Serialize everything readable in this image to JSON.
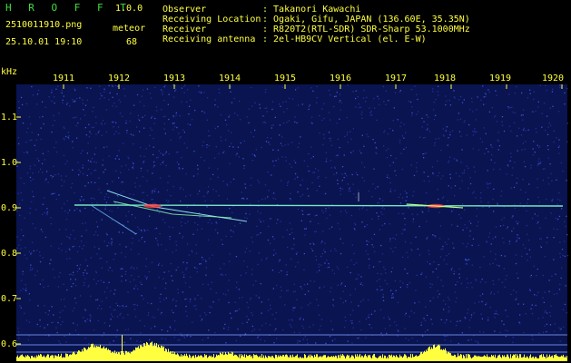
{
  "header": {
    "app_title": "H R O F F T",
    "version": "1.0.0",
    "filename": "2510011910.png",
    "meteor_label": "meteor",
    "datetime": "25.10.01 19:10",
    "meteor_count": "68",
    "info_labels": [
      "Observer",
      "Receiving Location",
      "Receiver",
      "Receiving antenna"
    ],
    "info_values": [
      ": Takanori Kawachi",
      ": Ogaki, Gifu, JAPAN (136.60E, 35.35N)",
      ": R820T2(RTL-SDR) SDR-Sharp 53.1000MHz",
      ": 2el-HB9CV Vertical (el. E-W)"
    ]
  },
  "axis": {
    "y_unit": "kHz",
    "x_ticks": [
      "1911",
      "1912",
      "1913",
      "1914",
      "1915",
      "1916",
      "1917",
      "1918",
      "1919",
      "1920"
    ],
    "y_ticks": [
      "1.1",
      "1.0",
      "0.9",
      "0.8",
      "0.7",
      "0.6"
    ]
  },
  "colors": {
    "background": "#000000",
    "spectrogram_noise": "#1a2a8a",
    "text_green": "#3fe03f",
    "text_yellow": "#ffff40",
    "signal_trace": "#7fffd0",
    "meteor_head": "#ff4040"
  }
}
